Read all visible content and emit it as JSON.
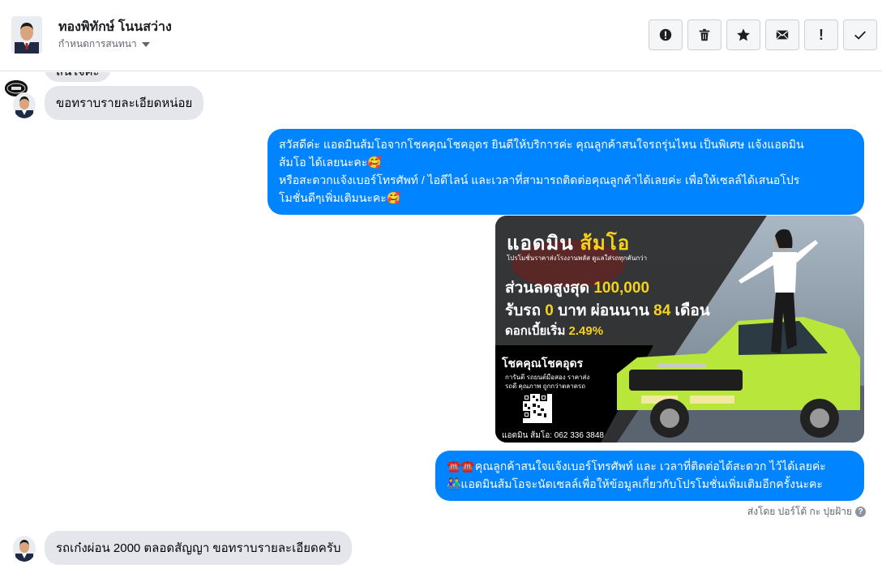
{
  "header": {
    "contact_name": "ทองพิทักษ์ โนนสว่าง",
    "assign_label": "กำหนดการสนทนา"
  },
  "toolbar": {
    "buttons": [
      {
        "name": "spam-button",
        "icon": "alert-circle-icon"
      },
      {
        "name": "delete-button",
        "icon": "trash-icon"
      },
      {
        "name": "star-button",
        "icon": "star-icon"
      },
      {
        "name": "mark-unread-button",
        "icon": "envelope-icon"
      },
      {
        "name": "important-button",
        "icon": "exclamation-icon"
      },
      {
        "name": "done-button",
        "icon": "check-icon"
      }
    ]
  },
  "messages": {
    "m0_partial": "สนใจคะ",
    "m1": "ขอทราบรายละเอียดหน่อย",
    "m2_line1": "สวัสดีค่ะ แอดมินส้มโอจากโชคคุณโชคอุดร ยินดีให้บริการค่ะ   คุณลูกค้าสนใจรถรุ่นไหน เป็นพิเศษ แจ้งแอดมิน",
    "m2_line2": "ส้มโอ ได้เลยนะคะ🥰",
    "m2_line3": "หรือสะดวกแจ้งเบอร์โทรศัพท์ / ไอดีไลน์ และเวลาที่สามารถติดต่อคุณลูกค้าได้เลยค่ะ เพื่อให้เซลล์ได้เสนอโปร",
    "m2_line4": "โมชั่นดีๆเพิ่มเติมนะคะ🥰",
    "m3_line1": "☎️☎️คุณลูกค้าสนใจแจ้งเบอร์โทรศัพท์ และ เวลาที่ติดต่อได้สะดวก ไว้ได้เลยค่ะ",
    "m3_line2": "👫แอดมินส้มโอจะนัดเซลล์เพื่อให้ข้อมูลเกี่ยวกับโปรโมชั่นเพิ่มเติมอีกครั้งนะคะ",
    "sent_by": "ส่งโดย ปอร์โต้ กะ ปุยฝ้าย",
    "m4": "รถเก๋งผ่อน 2000 ตลอดสัญญา  ขอทราบรายละเอียดครับ"
  },
  "promo": {
    "title_a": "แอดมิน",
    "title_b": "ส้มโอ",
    "tagline": "โปรโมชั่นราคาส่งโรงงานพลัส ดูแลใส่รถทุกคันกว่า",
    "discount_label": "ส่วนลดสูงสุด",
    "discount_value": "100,000",
    "pickup_a": "รับรถ",
    "pickup_zero": "0",
    "pickup_b": "บาท ผ่อนนาน",
    "pickup_months": "84",
    "pickup_c": "เดือน",
    "interest_label": "ดอกเบี้ยเริ่ม",
    "interest_value": "2.49%",
    "dealer": "โชคคุณโชคอุดร",
    "info_line1": "การันตี รถยนต์มือสอง ราคาส่ง",
    "info_line2": "รถดี คุณภาพ ถูกกว่าตลาดรถ",
    "phone": "แอดมิน ส้มโอ: 062 336 3848"
  },
  "colors": {
    "outgoing_bubble": "#0084ff",
    "incoming_bubble": "#e4e6eb",
    "car_body": "#b8e63a",
    "promo_yellow": "#f6d21c"
  }
}
